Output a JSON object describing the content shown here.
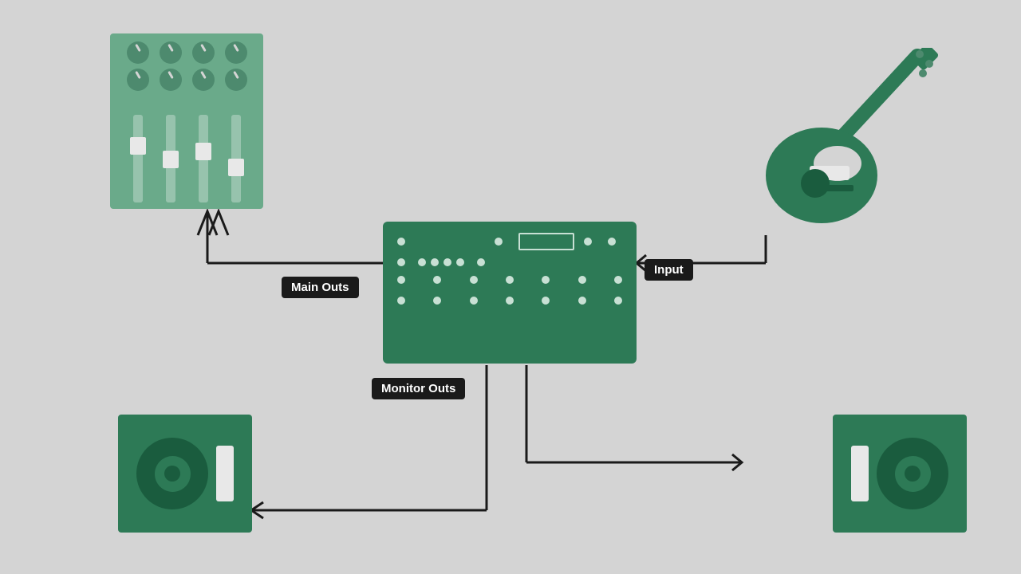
{
  "labels": {
    "main_outs": "Main Outs",
    "monitor_outs": "Monitor Outs",
    "input": "Input"
  },
  "colors": {
    "background": "#d4d4d4",
    "dark_green": "#2d7a56",
    "mid_green": "#6aaa8a",
    "light_dot": "#c8e0d4",
    "white": "#e8e8e8",
    "black": "#1a1a1a",
    "line": "#1a1a1a"
  }
}
